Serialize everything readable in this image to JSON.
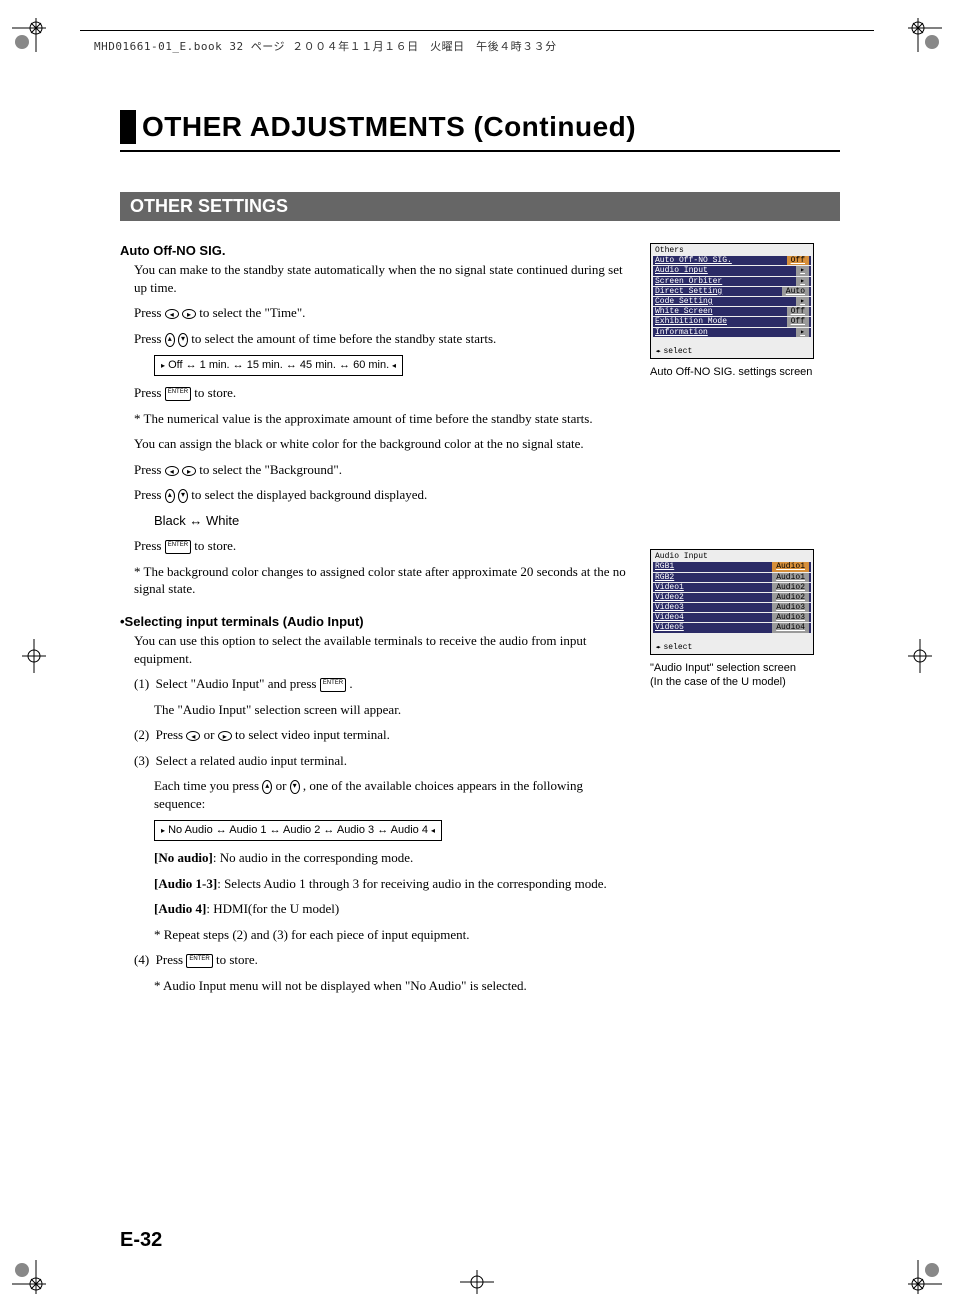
{
  "meta": {
    "topline": "MHD01661-01_E.book  32 ページ  ２００４年１１月１６日　火曜日　午後４時３３分"
  },
  "chapter": {
    "title": "OTHER ADJUSTMENTS (Continued)"
  },
  "section": {
    "title": "OTHER SETTINGS"
  },
  "auto_off": {
    "heading": "Auto Off-NO SIG.",
    "p1": "You can make to the standby state automatically when the no signal state continued during set up time.",
    "p2a": "Press ",
    "p2b": " to select the \"Time\".",
    "p3a": "Press ",
    "p3b": " to select the amount of time before the standby state starts.",
    "seq_time": "Off ↔ 1 min. ↔ 15 min. ↔ 45 min. ↔ 60 min.",
    "p4a": "Press ",
    "p4b": " to store.",
    "note1": "* The numerical value is the approximate amount of time before the standby state starts.",
    "p5": "You can assign the black or white color for the background color at the no signal state.",
    "p6a": "Press ",
    "p6b": " to select the \"Background\".",
    "p7a": "Press ",
    "p7b": " to select the displayed background displayed.",
    "seq_bg": "Black ↔ White",
    "p8a": "Press ",
    "p8b": " to store.",
    "note2": "* The background color changes to assigned color state after approximate 20 seconds at the no signal state."
  },
  "audio": {
    "heading": "•Selecting input terminals (Audio Input)",
    "p1": "You can use this option to select the available terminals to receive the audio from input equipment.",
    "s1n": "(1)",
    "s1a": "Select \"Audio Input\" and press ",
    "s1b": ".",
    "s1c": "The \"Audio Input\" selection screen will appear.",
    "s2n": "(2)",
    "s2a": "Press ",
    "s2b": " or ",
    "s2c": " to select video input terminal.",
    "s3n": "(3)",
    "s3a": "Select a related audio input terminal.",
    "s3b_a": "Each time you press ",
    "s3b_b": " or ",
    "s3b_c": ", one of the available choices appears in the following sequence:",
    "seq_audio": "No Audio ↔ Audio 1 ↔ Audio 2 ↔ Audio 3 ↔ Audio 4",
    "d_noaudio_k": "[No audio]",
    "d_noaudio_v": ": No audio in the corresponding mode.",
    "d_a13_k": "[Audio 1-3]",
    "d_a13_v": ": Selects Audio 1 through 3 for receiving audio in the corresponding mode.",
    "d_a4_k": "[Audio 4]",
    "d_a4_v": ": HDMI(for the U model)",
    "note1": "* Repeat steps (2) and (3) for each piece of input equipment.",
    "s4n": "(4)",
    "s4a": "Press ",
    "s4b": " to store.",
    "note2": "* Audio Input menu will not be displayed when \"No Audio\" is selected."
  },
  "osd1": {
    "title": "Others",
    "rows": [
      {
        "label": "Auto Off-NO SIG.",
        "val": "Off",
        "hl": true
      },
      {
        "label": "Audio Input",
        "val": "▸"
      },
      {
        "label": "Screen Orbiter",
        "val": "▸"
      },
      {
        "label": "Direct Setting",
        "val": "Auto"
      },
      {
        "label": "Code Setting",
        "val": "▸"
      },
      {
        "label": "White Screen",
        "val": "Off"
      },
      {
        "label": "Exhibition Mode",
        "val": "Off"
      },
      {
        "label": "Information",
        "val": "▸"
      }
    ],
    "foot": "select",
    "caption": "Auto Off-NO SIG. settings screen"
  },
  "osd2": {
    "title": "Audio Input",
    "rows": [
      {
        "label": "RGB1",
        "val": "Audio1",
        "hl": true
      },
      {
        "label": "RGB2",
        "val": "Audio1"
      },
      {
        "label": "Video1",
        "val": "Audio2"
      },
      {
        "label": "Video2",
        "val": "Audio2"
      },
      {
        "label": "Video3",
        "val": "Audio3"
      },
      {
        "label": "Video4",
        "val": "Audio3"
      },
      {
        "label": "Video5",
        "val": "Audio4"
      }
    ],
    "foot": "select",
    "caption1": "\"Audio Input\" selection screen",
    "caption2": "(In the case of the U model)"
  },
  "pagenum": "E-32"
}
